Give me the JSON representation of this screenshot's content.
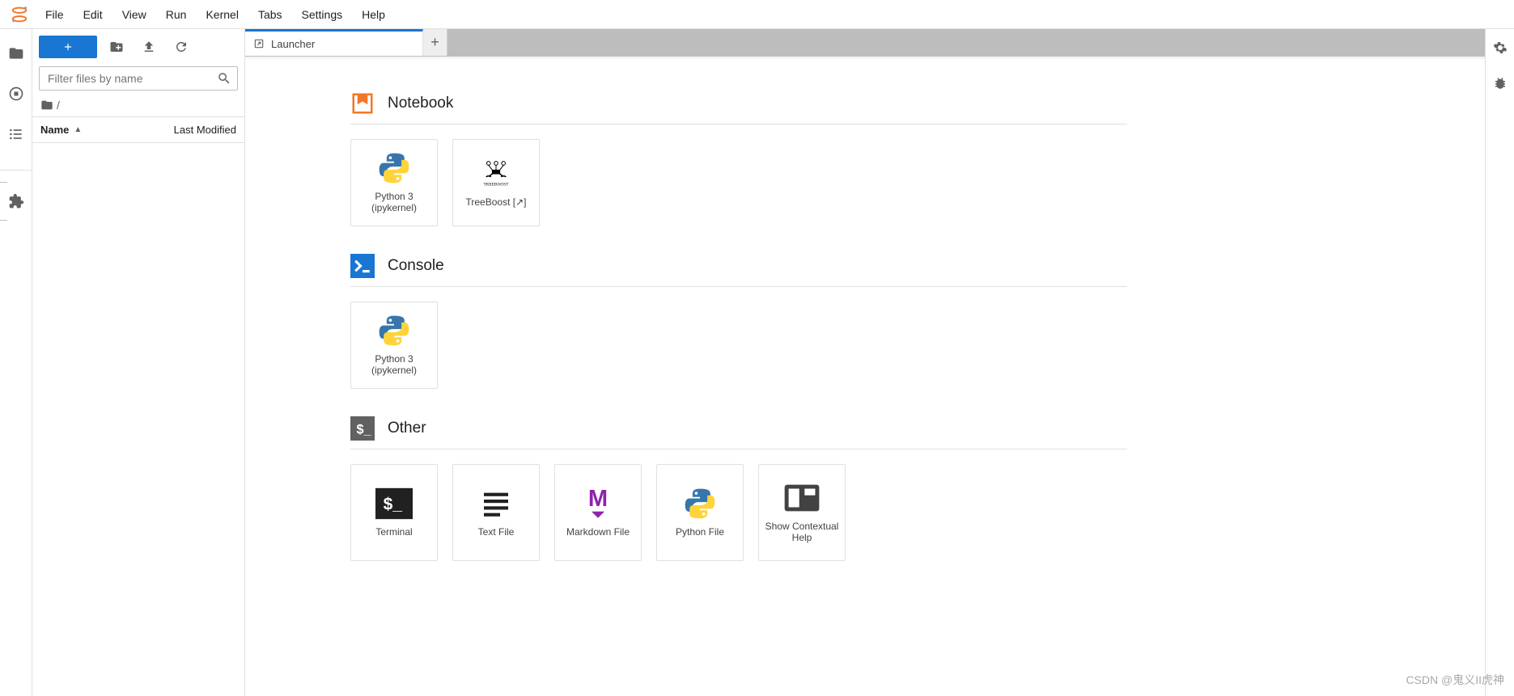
{
  "menu": [
    "File",
    "Edit",
    "View",
    "Run",
    "Kernel",
    "Tabs",
    "Settings",
    "Help"
  ],
  "file_panel": {
    "filter_placeholder": "Filter files by name",
    "breadcrumb": "/",
    "columns": {
      "name": "Name",
      "modified": "Last Modified"
    }
  },
  "tab": {
    "title": "Launcher"
  },
  "sections": {
    "notebook": {
      "title": "Notebook",
      "cards": [
        {
          "label": "Python 3 (ipykernel)"
        },
        {
          "label": "TreeBoost [↗]"
        }
      ]
    },
    "console": {
      "title": "Console",
      "cards": [
        {
          "label": "Python 3 (ipykernel)"
        }
      ]
    },
    "other": {
      "title": "Other",
      "cards": [
        {
          "label": "Terminal"
        },
        {
          "label": "Text File"
        },
        {
          "label": "Markdown File"
        },
        {
          "label": "Python File"
        },
        {
          "label": "Show Contextual Help"
        }
      ]
    }
  },
  "watermark": "CSDN @鬼义II虎神"
}
